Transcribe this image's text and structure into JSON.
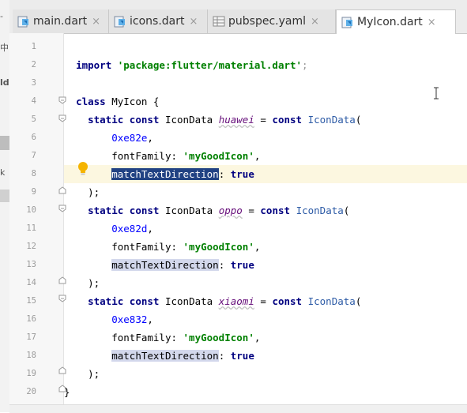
{
  "left_panel": {
    "marks": [
      "-",
      "中",
      "ld",
      "k",
      "-"
    ]
  },
  "tabs": [
    {
      "label": "main.dart",
      "icon": "dart-file-icon",
      "close": "×"
    },
    {
      "label": "icons.dart",
      "icon": "dart-file-icon",
      "close": "×"
    },
    {
      "label": "pubspec.yaml",
      "icon": "yaml-file-icon",
      "close": "×"
    },
    {
      "label": "MyIcon.dart",
      "icon": "dart-file-icon",
      "close": "×",
      "active": true
    }
  ],
  "editor": {
    "line_numbers": [
      "1",
      "2",
      "3",
      "4",
      "5",
      "6",
      "7",
      "8",
      "9",
      "10",
      "11",
      "12",
      "13",
      "14",
      "15",
      "16",
      "17",
      "18",
      "19",
      "20"
    ],
    "current_line": 8,
    "code": {
      "l2_import": "import",
      "l2_str": "'package:flutter/material.dart'",
      "l2_semi": ";",
      "l4_class": "class",
      "l4_name": " MyIcon {",
      "static": "static",
      "const": "const",
      "type": " IconData ",
      "eq": " = ",
      "ctor": "IconData",
      "paren_open": "(",
      "names": [
        "huawei",
        "oppo",
        "xiaomi"
      ],
      "codes": [
        "0xe82e",
        "0xe82d",
        "0xe832"
      ],
      "fontFamily": "fontFamily: ",
      "font_val": "'myGoodIcon'",
      "comma": ",",
      "matchTextDirection": "matchTextDirection",
      "colon": ": ",
      "true": "true",
      "close": ");",
      "brace": "}"
    }
  },
  "colors": {
    "keyword": "#000080",
    "string": "#008000",
    "number": "#0000ff",
    "caret_row": "#fcf7e0",
    "selection": "#214283"
  }
}
